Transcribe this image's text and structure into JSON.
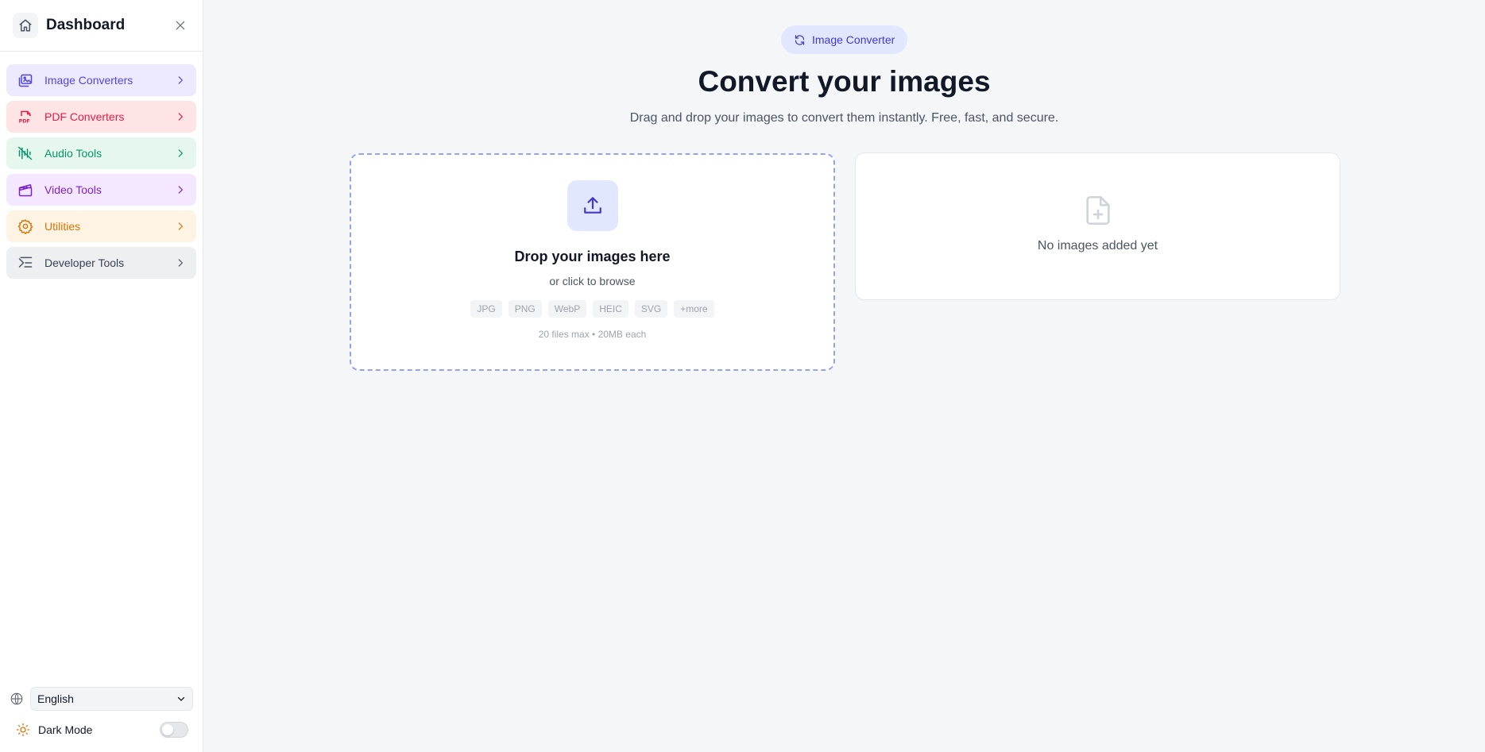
{
  "sidebar": {
    "title": "Dashboard",
    "items": [
      {
        "label": "Image Converters",
        "color": "#4f46e5",
        "bg": "#ede9fe"
      },
      {
        "label": "PDF Converters",
        "color": "#e11d48",
        "bg": "#ffe4e6"
      },
      {
        "label": "Audio Tools",
        "color": "#059669",
        "bg": "#e6f7f0"
      },
      {
        "label": "Video Tools",
        "color": "#7e22ce",
        "bg": "#f3e8ff"
      },
      {
        "label": "Utilities",
        "color": "#d97706",
        "bg": "#fff3e3"
      },
      {
        "label": "Developer Tools",
        "color": "#374151",
        "bg": "#eeeff1"
      }
    ],
    "language": "English",
    "dark_mode_label": "Dark Mode",
    "dark_mode_on": false
  },
  "main": {
    "badge": "Image Converter",
    "headline": "Convert your images",
    "subline": "Drag and drop your images to convert them instantly. Free, fast, and secure.",
    "dropzone": {
      "title": "Drop your images here",
      "subtitle": "or click to browse",
      "formats": [
        "JPG",
        "PNG",
        "WebP",
        "HEIC",
        "SVG",
        "+more"
      ],
      "limit": "20 files max • 20MB each"
    },
    "preview": {
      "empty_text": "No images added yet"
    }
  }
}
